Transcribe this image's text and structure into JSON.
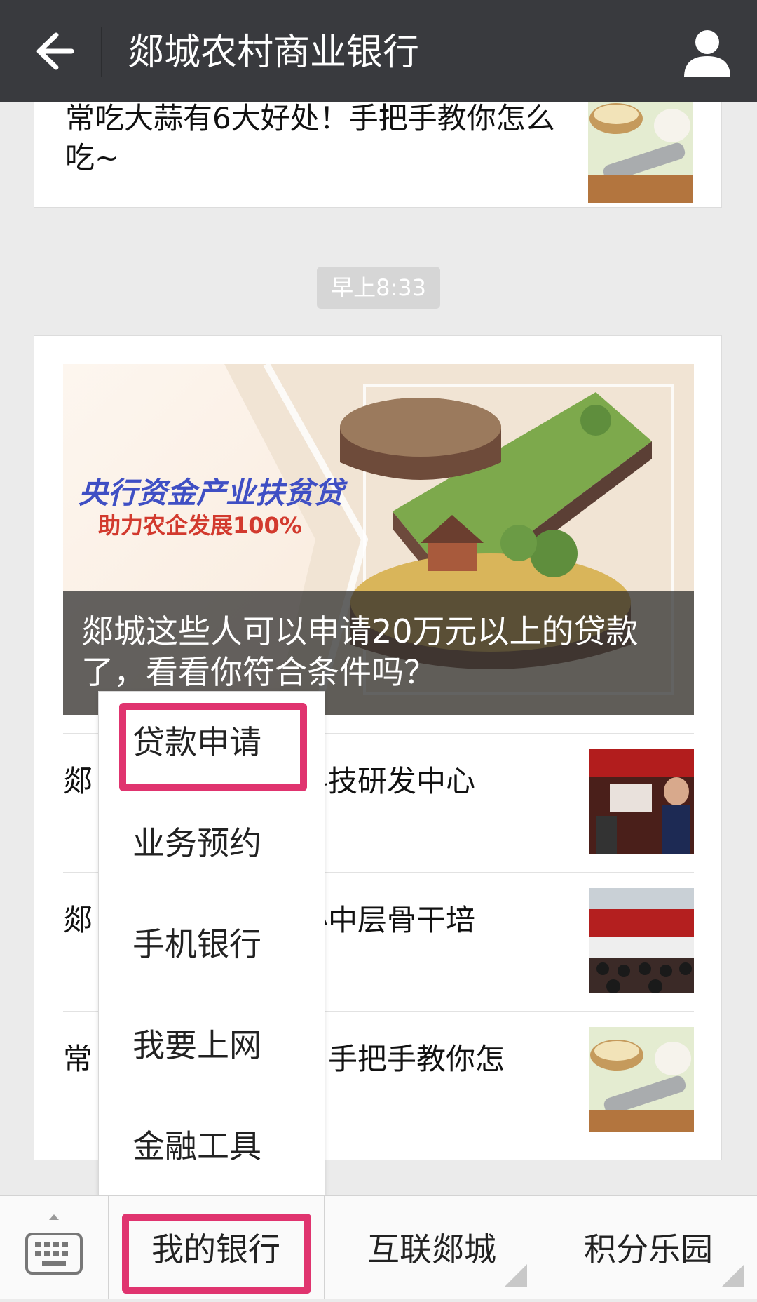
{
  "header": {
    "title": "郯城农村商业银行",
    "back_icon": "arrow-left-icon",
    "user_icon": "user-icon"
  },
  "top_article": {
    "title": "常吃大蒜有6大好处！手把手教你怎么吃~"
  },
  "timestamp": "早上8:33",
  "main_article": {
    "cover_headline": "央行资金产业扶贫贷",
    "cover_subheadline": "助力农企发展100%",
    "title": "郯城这些人可以申请20万元以上的贷款了，看看你符合条件吗？"
  },
  "sub_articles": [
    {
      "visible_title": "郯　　　　　　融科技研发中心"
    },
    {
      "visible_title": "郯　　　　　　举办中层骨干培"
    },
    {
      "visible_title": "常　　　　　　处！手把手教你怎"
    }
  ],
  "popup_menu": {
    "items": [
      "贷款申请",
      "业务预约",
      "手机银行",
      "我要上网",
      "金融工具"
    ]
  },
  "bottom_menu": {
    "tabs": [
      "我的银行",
      "互联郯城",
      "积分乐园"
    ]
  },
  "colors": {
    "header_bg": "#393a3e",
    "highlight": "#e0346f",
    "page_bg": "#ebebeb"
  }
}
